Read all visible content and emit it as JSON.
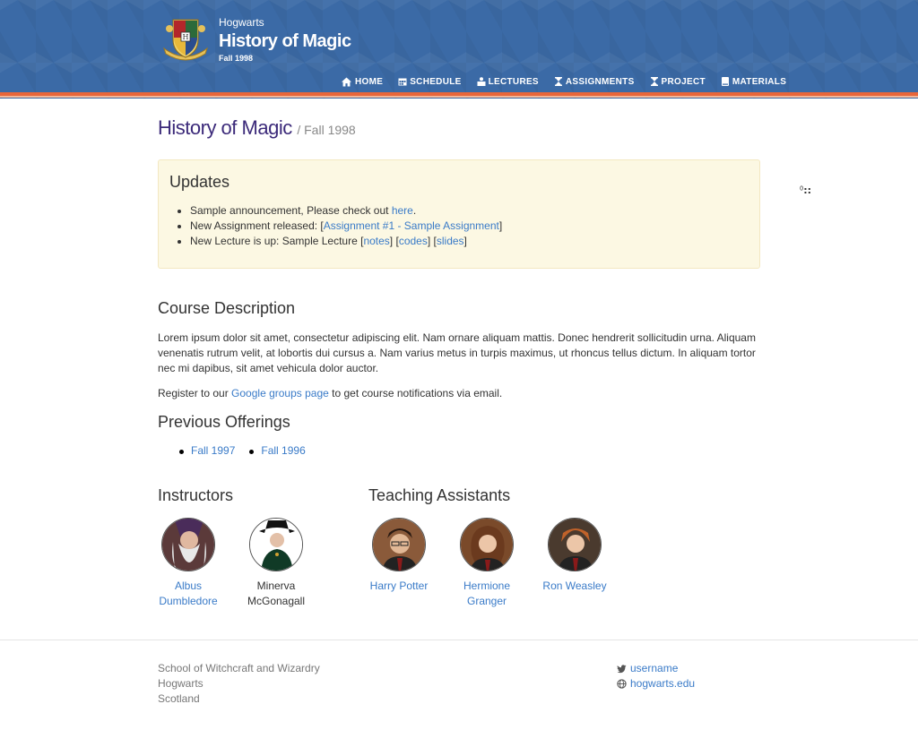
{
  "header": {
    "school": "Hogwarts",
    "course": "History of Magic",
    "term": "Fall 1998",
    "nav": [
      {
        "label": "HOME",
        "icon": "home-icon"
      },
      {
        "label": "SCHEDULE",
        "icon": "calendar-icon"
      },
      {
        "label": "LECTURES",
        "icon": "lectures-icon"
      },
      {
        "label": "ASSIGNMENTS",
        "icon": "hourglass-icon"
      },
      {
        "label": "PROJECT",
        "icon": "hourglass-icon"
      },
      {
        "label": "MATERIALS",
        "icon": "book-icon"
      }
    ],
    "colors": {
      "banner": "#3b6aa6",
      "stripe": "#e8663a"
    }
  },
  "main": {
    "title": "History of Magic",
    "subtitle": "/ Fall 1998",
    "updates": {
      "heading": "Updates",
      "item1_text": "Sample announcement, Please check out ",
      "item1_link": "here",
      "item1_end": ".",
      "item2_text": "New Assignment released: [",
      "item2_link": "Assignment #1 - Sample Assignment",
      "item2_end": "]",
      "item3_text": "New Lecture is up: Sample Lecture [",
      "item3_link1": "notes",
      "item3_link2": "codes",
      "item3_link3": "slides",
      "sep1": "] [",
      "sep2": "] [",
      "item3_end": "]"
    },
    "side_mark_small": "0",
    "side_mark_big": "::",
    "description": {
      "heading": "Course Description",
      "body": "Lorem ipsum dolor sit amet, consectetur adipiscing elit. Nam ornare aliquam mattis. Donec hendrerit sollicitudin urna. Aliquam venenatis rutrum velit, at lobortis dui cursus a. Nam varius metus in turpis maximus, ut rhoncus tellus dictum. In aliquam tortor nec mi dapibus, sit amet vehicula dolor auctor.",
      "register_pre": "Register to our ",
      "register_link": "Google groups page",
      "register_post": " to get course notifications via email."
    },
    "previous": {
      "heading": "Previous Offerings",
      "items": [
        "Fall 1997",
        "Fall 1996"
      ]
    },
    "instructors": {
      "heading": "Instructors",
      "people": [
        "Albus Dumbledore",
        "Minerva McGonagall"
      ]
    },
    "tas": {
      "heading": "Teaching Assistants",
      "people": [
        "Harry Potter",
        "Hermione Granger",
        "Ron Weasley"
      ]
    }
  },
  "footer": {
    "address": [
      "School of Witchcraft and Wizardry",
      "Hogwarts",
      "Scotland"
    ],
    "twitter": "username",
    "website": "hogwarts.edu"
  }
}
